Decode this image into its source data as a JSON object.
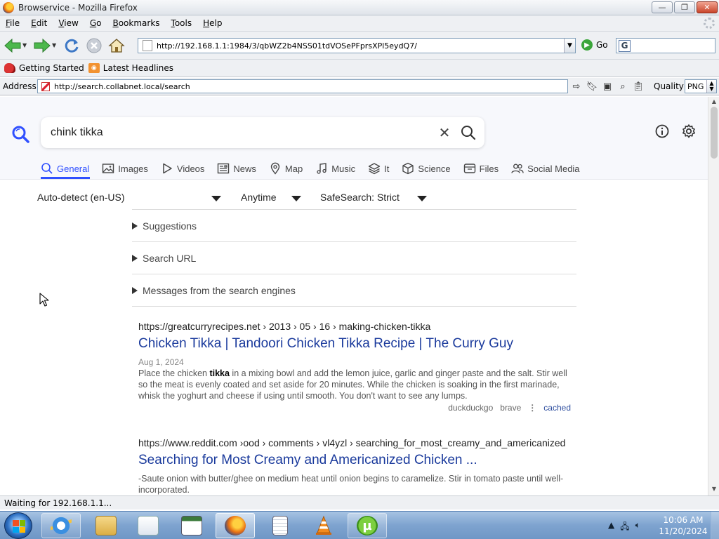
{
  "window": {
    "title": "Browservice - Mozilla Firefox",
    "buttons": {
      "minimize": "—",
      "maximize": "❐",
      "close": "✕"
    }
  },
  "menubar": {
    "items": [
      "File",
      "Edit",
      "View",
      "Go",
      "Bookmarks",
      "Tools",
      "Help"
    ]
  },
  "navbar": {
    "url": "http://192.168.1.1:1984/3/qbWZ2b4NSS01tdVOSePFprsXPl5eydQ7/",
    "go_label": "Go"
  },
  "bookmarks": {
    "items": [
      "Getting Started",
      "Latest Headlines"
    ]
  },
  "addressbar": {
    "label": "Address",
    "url": "http://search.collabnet.local/search",
    "quality_label": "Quality",
    "quality_value": "PNG"
  },
  "search": {
    "query": "chink tikka",
    "tabs": [
      "General",
      "Images",
      "Videos",
      "News",
      "Map",
      "Music",
      "It",
      "Science",
      "Files",
      "Social Media"
    ],
    "active_tab": "General",
    "filters": {
      "language": "Auto-detect (en-US)",
      "time": "Anytime",
      "safesearch": "SafeSearch: Strict"
    },
    "details": [
      "Suggestions",
      "Search URL",
      "Messages from the search engines"
    ]
  },
  "results": [
    {
      "url": "https://greatcurryrecipes.net  › 2013 › 05 › 16 › making-chicken-tikka",
      "title": "Chicken Tikka | Tandoori Chicken Tikka Recipe | The Curry Guy",
      "date": "Aug 1, 2024",
      "snippet_before": "Place the chicken ",
      "snippet_bold": "tikka",
      "snippet_after": " in a mixing bowl and add the lemon juice, garlic and ginger paste and the salt. Stir well so the meat is evenly coated and set aside for 20 minutes. While the chicken is soaking in the first marinade, whisk the yoghurt and cheese if using until smooth. You don't want to see any lumps.",
      "engines": [
        "duckduckgo",
        "brave"
      ],
      "cached_label": "cached"
    },
    {
      "url": "https://www.reddit.com  ›ood › comments › vl4yzl › searching_for_most_creamy_and_americanized",
      "title": "Searching for Most Creamy and Americanized Chicken ...",
      "snippet": "-Saute onion with butter/ghee on medium heat until onion begins to caramelize. Stir in tomato paste until well-incorporated."
    }
  ],
  "status": {
    "text": "Waiting for 192.168.1.1..."
  },
  "taskbar": {
    "time": "10:06 AM",
    "date": "11/20/2024",
    "apps": [
      "internet-explorer",
      "file-explorer",
      "media-player",
      "window-app",
      "firefox",
      "notepad-doc",
      "vlc",
      "utorrent"
    ],
    "active_app": "firefox"
  },
  "colors": {
    "accent": "#3050ff",
    "result_title": "#1a3a9c",
    "taskbar": "#7ea3cf"
  }
}
